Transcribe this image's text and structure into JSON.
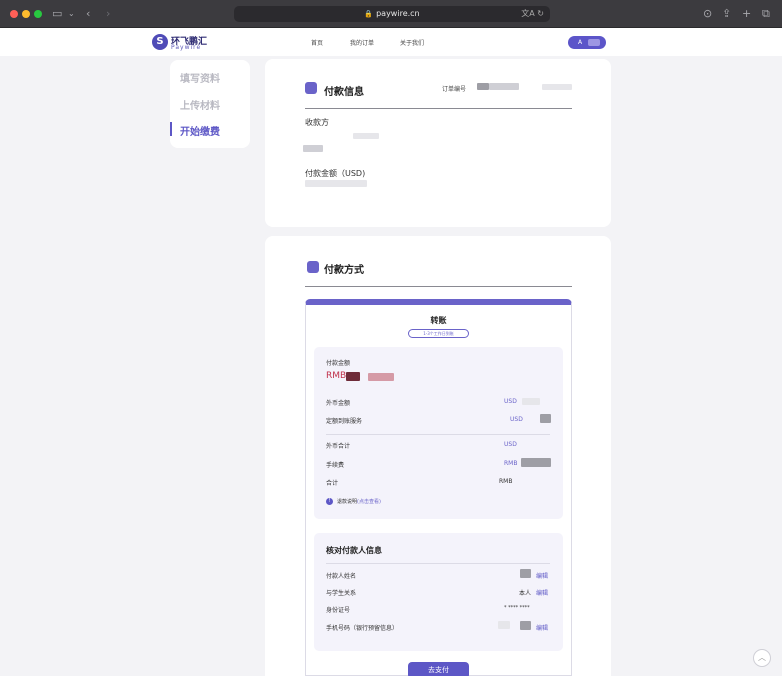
{
  "browser": {
    "url": "paywire.cn",
    "translate_label": "文A",
    "reload_label": "↻"
  },
  "brand": {
    "name_cn": "环飞鹏汇",
    "name_en": "Paywire",
    "accent": "#5d57c6"
  },
  "nav": {
    "links": [
      "首页",
      "我的订单",
      "关于我们"
    ],
    "user_initial": "A"
  },
  "steps": [
    {
      "label": "填写资料",
      "active": false
    },
    {
      "label": "上传材料",
      "active": false
    },
    {
      "label": "开始缴费",
      "active": true
    }
  ],
  "payment_info": {
    "title": "付款信息",
    "order_label": "订单编号",
    "payee_label": "收款方",
    "amount_label": "付款金额（USD)"
  },
  "payment_method": {
    "title": "付款方式",
    "method_title": "转账",
    "method_badge": "1-3个工作日到账",
    "amount_section": {
      "pay_amount_label": "付款金额",
      "currency": "RMB",
      "rows": [
        {
          "label": "外币金额",
          "value": "USD"
        },
        {
          "label": "定额到账服务",
          "value": "USD"
        },
        {
          "label": "外币合计",
          "value": "USD"
        },
        {
          "label": "手续费",
          "value": "RMB"
        },
        {
          "label": "合计",
          "value": "RMB"
        }
      ],
      "refund_note": "退款说明",
      "refund_link": "(点击查看)"
    },
    "payer_section": {
      "title": "核对付款人信息",
      "rows": [
        {
          "label": "付款人姓名",
          "value": "",
          "edit": "编辑"
        },
        {
          "label": "与学生关系",
          "value": "本人",
          "edit": "编辑"
        },
        {
          "label": "身份证号",
          "value": "* **** ****",
          "edit": ""
        },
        {
          "label": "手机号码（银行预留信息）",
          "value": "",
          "edit": "编辑"
        }
      ]
    },
    "pay_button": "去支付"
  }
}
